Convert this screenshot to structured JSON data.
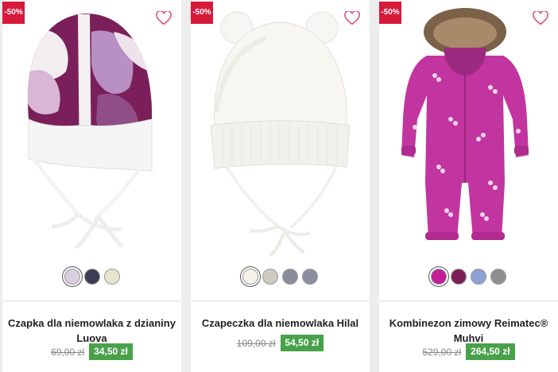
{
  "products": [
    {
      "badge": "-50%",
      "name": "Czapka dla niemowlaka z dzianiny Luova",
      "old_price": "69,00 zł",
      "new_price": "34,50 zł",
      "swatches": [
        "#d9cfe0",
        "#3a3e52",
        "#e8e4cc"
      ],
      "selected_swatch": 0
    },
    {
      "badge": "-50%",
      "name": "Czapeczka dla niemowlaka Hilal",
      "old_price": "109,00 zł",
      "new_price": "54,50 zł",
      "swatches": [
        "#f4f1e8",
        "#cfc9c0",
        "#8a8d98",
        "#8a8f9e"
      ],
      "selected_swatch": 0
    },
    {
      "badge": "-50%",
      "name": "Kombinezon zimowy Reimatec® Muhvi",
      "old_price": "529,00 zł",
      "new_price": "264,50 zł",
      "swatches": [
        "#c21e9a",
        "#7d1f55",
        "#8fa0d6",
        "#8f8f8f"
      ],
      "selected_swatch": 0
    }
  ],
  "icons": {
    "wishlist": "heart-outline-icon"
  },
  "colors": {
    "badge": "#d7193c",
    "price_new_bg": "#4aa14b",
    "heart": "#e0436a"
  }
}
